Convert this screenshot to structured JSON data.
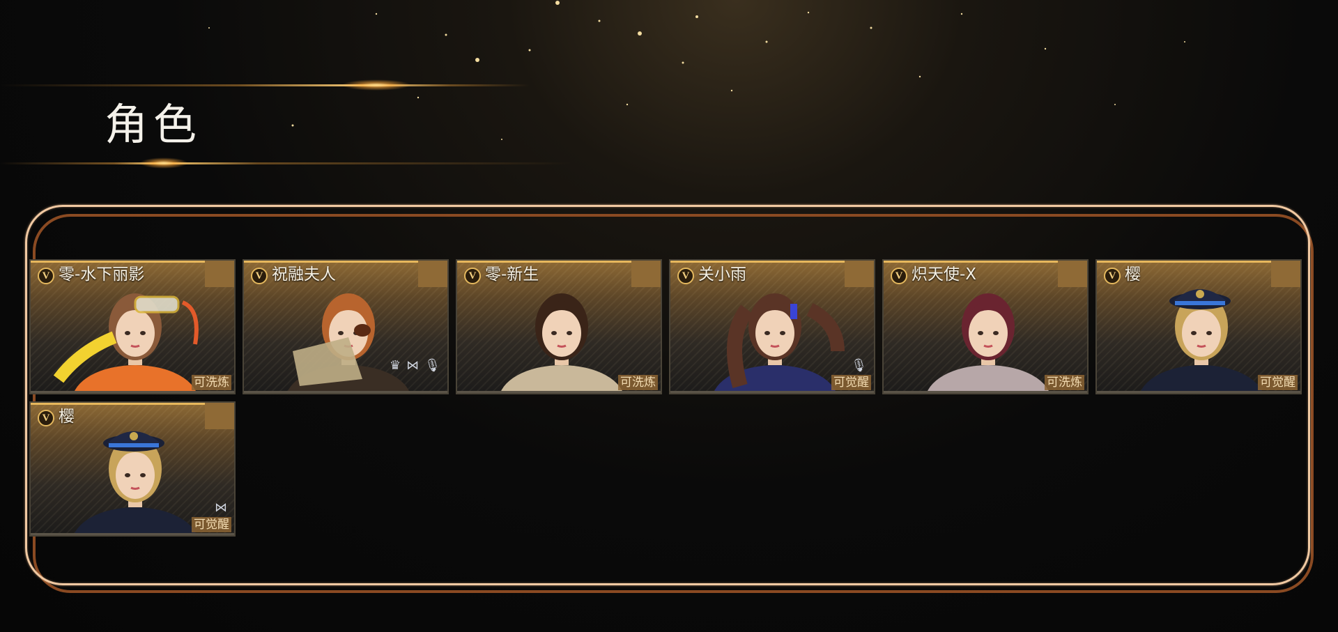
{
  "page": {
    "title": "角色"
  },
  "colors": {
    "accent_gold": "#e4b85e",
    "panel_border": "#f1c9a2",
    "panel_border_shadow": "#8a4a22",
    "status_bg": "#8c6432"
  },
  "characters": [
    {
      "badge": "V",
      "name": "零-水下丽影",
      "status": "可洗炼",
      "icons": [],
      "hair": "#8a5a3a",
      "outfit": "#e8722a",
      "extra": "goggles"
    },
    {
      "badge": "V",
      "name": "祝融夫人",
      "status": "",
      "icons": [
        "crown-icon",
        "bow-icon",
        "mic-icon"
      ],
      "hair": "#b8642e",
      "outfit": "#3a2e24",
      "extra": "eyepatch"
    },
    {
      "badge": "V",
      "name": "零-新生",
      "status": "可洗炼",
      "icons": [],
      "hair": "#3a2418",
      "outfit": "#c9b89a",
      "extra": "none"
    },
    {
      "badge": "V",
      "name": "关小雨",
      "status": "可觉醒",
      "icons": [
        "mic-icon"
      ],
      "hair": "#5a3426",
      "outfit": "#2a2f6a",
      "extra": "twintails"
    },
    {
      "badge": "V",
      "name": "炽天使-X",
      "status": "可洗炼",
      "icons": [],
      "hair": "#6a2430",
      "outfit": "#b7a7a8",
      "extra": "none"
    },
    {
      "badge": "V",
      "name": "樱",
      "status": "可觉醒",
      "icons": [],
      "hair": "#c8a45a",
      "outfit": "#1c2236",
      "extra": "captain-hat"
    },
    {
      "badge": "V",
      "name": "樱",
      "status": "可觉醒",
      "icons": [
        "bow-icon"
      ],
      "hair": "#c8a45a",
      "outfit": "#1c2236",
      "extra": "captain-hat"
    }
  ]
}
